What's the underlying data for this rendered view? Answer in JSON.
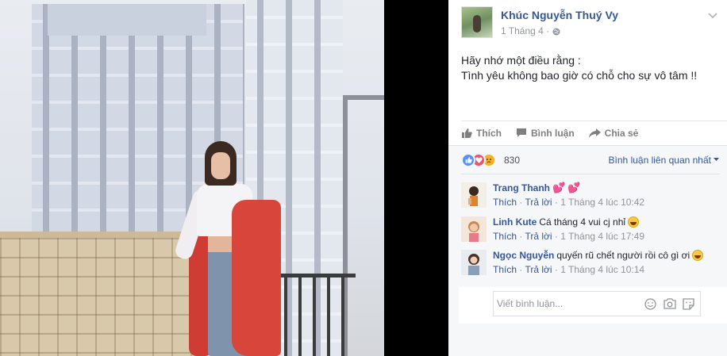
{
  "post": {
    "author_name": "Khúc Nguyễn Thuý Vy",
    "timestamp": "1 Tháng 4 ·",
    "text_line1": "Hãy nhớ một điều rằng :",
    "text_line2": "Tình yêu không bao giờ có chỗ cho sự vô tâm !!"
  },
  "actions": {
    "like": "Thích",
    "comment": "Bình luận",
    "share": "Chia sẻ"
  },
  "reactions": {
    "count": "830",
    "types": [
      "like-icon",
      "love-icon",
      "sad-icon"
    ],
    "sort_label": "Bình luận liên quan nhất"
  },
  "comments": [
    {
      "name": "Trang Thanh",
      "text": "",
      "like": "Thích",
      "reply": "Trả lời",
      "time": "1 Tháng 4 lúc 10:42",
      "emoji": "hearts"
    },
    {
      "name": "Linh Kute",
      "text": "Cá tháng 4 vui cj nhỉ",
      "like": "Thích",
      "reply": "Trả lời",
      "time": "1 Tháng 4 lúc 17:49",
      "emoji": "laugh"
    },
    {
      "name": "Ngọc Nguyễn",
      "text": "quyến rũ chết người rồi cô gì ơi",
      "like": "Thích",
      "reply": "Trả lời",
      "time": "1 Tháng 4 lúc 10:14",
      "emoji": "laugh"
    }
  ],
  "composer": {
    "placeholder": "Viết bình luận..."
  },
  "colors": {
    "link": "#365899",
    "meta": "#90949c",
    "like_blue": "#5890ff",
    "love_red": "#f25268"
  }
}
